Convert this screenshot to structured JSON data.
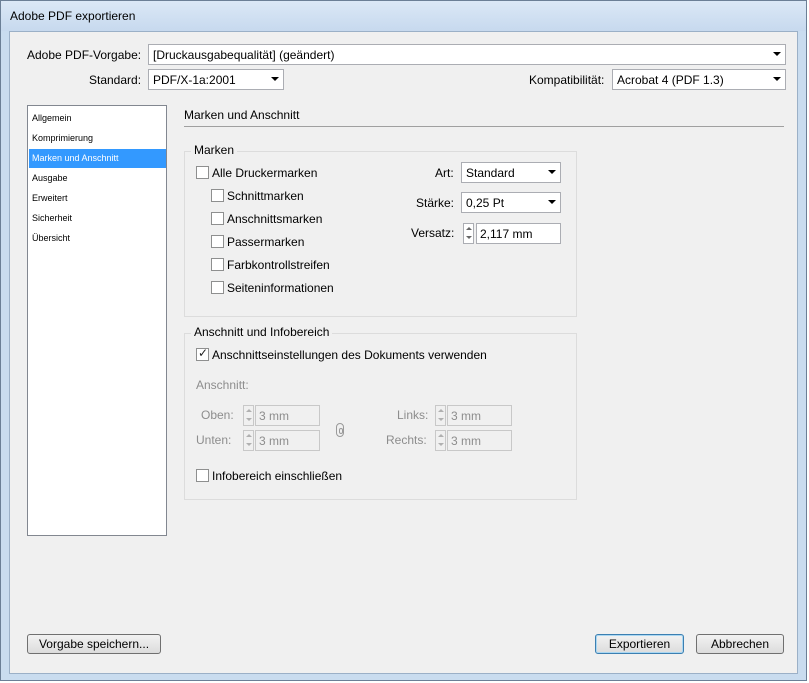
{
  "window": {
    "title": "Adobe PDF exportieren",
    "background_color": "#c9dcef"
  },
  "top": {
    "preset_label": "Adobe PDF-Vorgabe:",
    "preset_value": "[Druckausgabequalität] (geändert)",
    "standard_label": "Standard:",
    "standard_value": "PDF/X-1a:2001",
    "compat_label": "Kompatibilität:",
    "compat_value": "Acrobat 4 (PDF 1.3)"
  },
  "sidebar": {
    "items": [
      {
        "label": "Allgemein"
      },
      {
        "label": "Komprimierung"
      },
      {
        "label": "Marken und Anschnitt",
        "selected": true
      },
      {
        "label": "Ausgabe"
      },
      {
        "label": "Erweitert"
      },
      {
        "label": "Sicherheit"
      },
      {
        "label": "Übersicht"
      }
    ],
    "selected_color": "#3399ff"
  },
  "section": {
    "title": "Marken und Anschnitt"
  },
  "marks": {
    "group_title": "Marken",
    "all_printer_marks": {
      "label": "Alle Druckermarken",
      "checked": false
    },
    "options": [
      {
        "label": "Schnittmarken",
        "checked": false
      },
      {
        "label": "Anschnittsmarken",
        "checked": false
      },
      {
        "label": "Passermarken",
        "checked": false
      },
      {
        "label": "Farbkontrollstreifen",
        "checked": false
      },
      {
        "label": "Seiteninformationen",
        "checked": false
      }
    ],
    "type_label": "Art:",
    "type_value": "Standard",
    "weight_label": "Stärke:",
    "weight_value": "0,25 Pt",
    "offset_label": "Versatz:",
    "offset_value": "2,117 mm"
  },
  "bleed": {
    "group_title": "Anschnitt und Infobereich",
    "use_doc": {
      "label": "Anschnittseinstellungen des Dokuments verwenden",
      "checked": true
    },
    "bleed_label": "Anschnitt:",
    "top_label": "Oben:",
    "top_value": "3 mm",
    "bottom_label": "Unten:",
    "bottom_value": "3 mm",
    "left_label": "Links:",
    "left_value": "3 mm",
    "right_label": "Rechts:",
    "right_value": "3 mm",
    "slug": {
      "label": "Infobereich einschließen",
      "checked": false
    }
  },
  "buttons": {
    "save_preset": "Vorgabe speichern...",
    "export": "Exportieren",
    "cancel": "Abbrechen"
  },
  "icons": {
    "link": "chain-link-icon",
    "dropdown": "chevron-down-icon",
    "spinner": "spinner-arrows-icon"
  }
}
